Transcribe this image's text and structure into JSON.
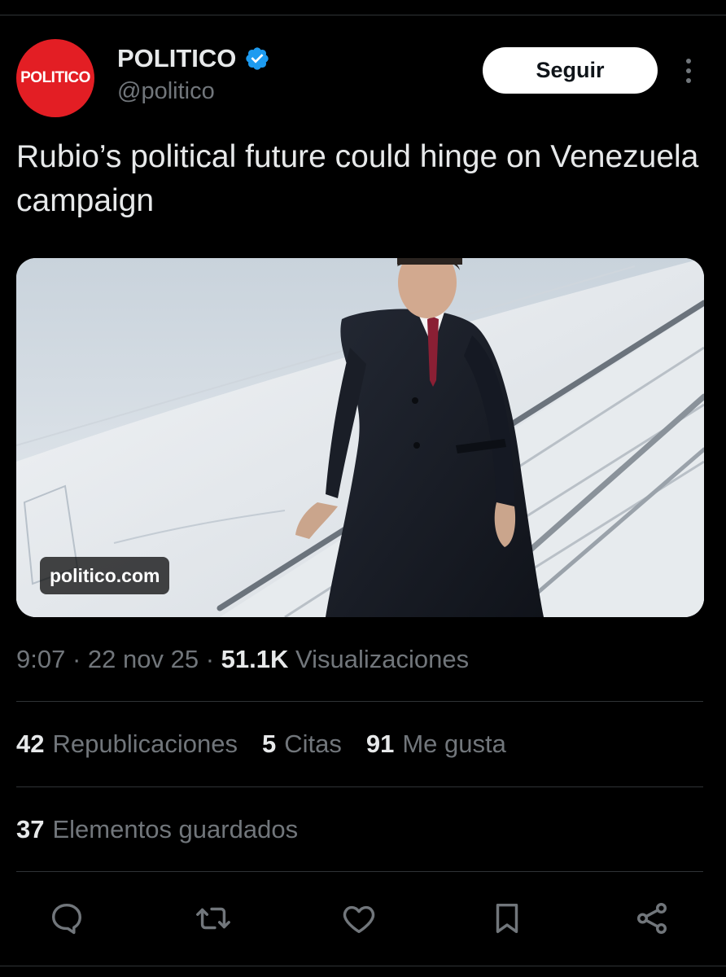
{
  "author": {
    "avatar_text": "POLITICO",
    "avatar_color": "#e31e24",
    "display_name": "POLITICO",
    "handle": "@politico",
    "verified": true,
    "verified_color": "#1d9bf0"
  },
  "follow_label": "Seguir",
  "tweet_text": "Rubio’s political future could hinge on Venezuela campaign",
  "media": {
    "domain": "politico.com"
  },
  "meta": {
    "time": "9:07",
    "sep1": " · ",
    "date": "22 nov 25",
    "sep2": " · ",
    "views_count": "51.1K",
    "views_label": " Visualizaciones"
  },
  "stats": {
    "reposts_count": "42",
    "reposts_label": "Republicaciones",
    "quotes_count": "5",
    "quotes_label": "Citas",
    "likes_count": "91",
    "likes_label": "Me gusta",
    "bookmarks_count": "37",
    "bookmarks_label": "Elementos guardados"
  },
  "actions": {
    "icons": [
      "reply-icon",
      "repost-icon",
      "like-icon",
      "bookmark-icon",
      "share-icon"
    ],
    "icon_color": "#71767b"
  },
  "colors": {
    "background": "#000000",
    "text_primary": "#e7e9ea",
    "text_secondary": "#71767b",
    "divider": "#2f3336"
  }
}
